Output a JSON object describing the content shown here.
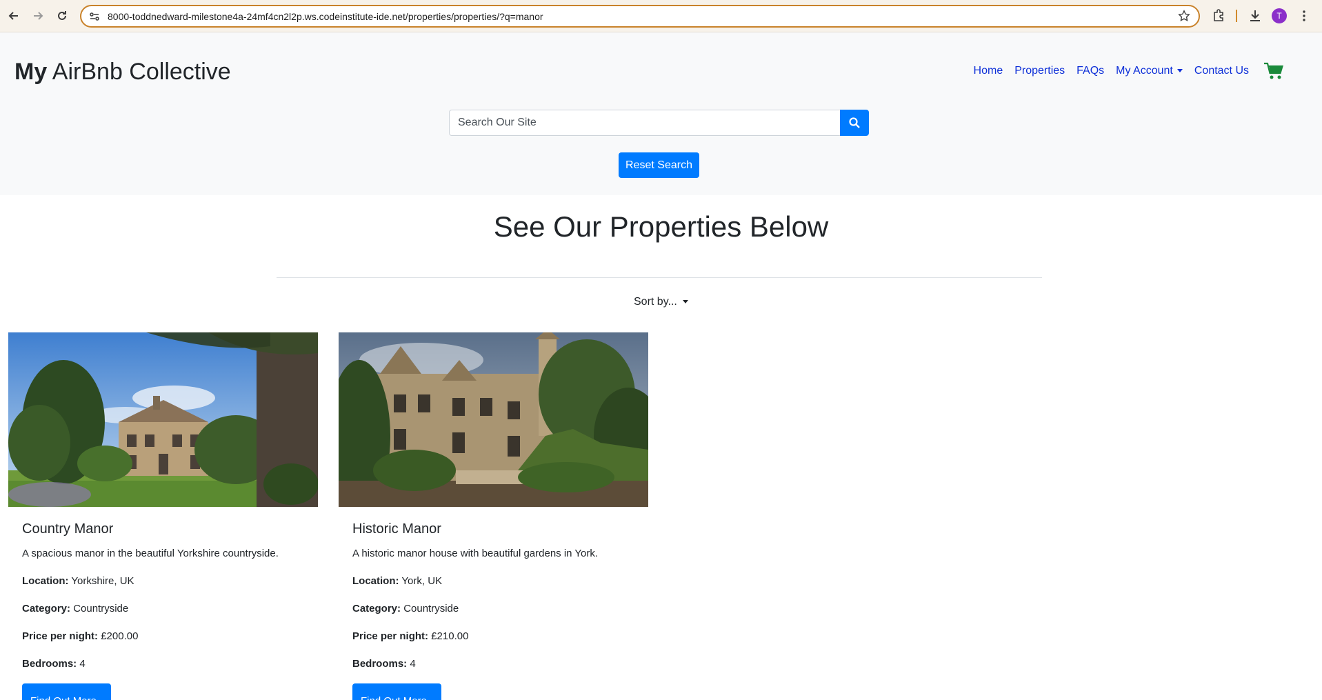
{
  "browser": {
    "url": "8000-toddnedward-milestone4a-24mf4cn2l2p.ws.codeinstitute-ide.net/properties/properties/?q=manor",
    "profile_initial": "T",
    "accent_color": "#c9822a"
  },
  "header": {
    "brand_bold": "My",
    "brand_rest": " AirBnb Collective",
    "nav": {
      "home": "Home",
      "properties": "Properties",
      "faqs": "FAQs",
      "account": "My Account",
      "contact": "Contact Us"
    },
    "cart_icon": "shopping-cart-icon",
    "search_placeholder": "Search Our Site",
    "search_icon": "search-icon",
    "reset_label": "Reset Search"
  },
  "main": {
    "heading": "See Our Properties Below",
    "sort_label": "Sort by..."
  },
  "properties": [
    {
      "title": "Country Manor",
      "description": "A spacious manor in the beautiful Yorkshire countryside.",
      "location_label": "Location:",
      "location": "Yorkshire, UK",
      "category_label": "Category:",
      "category": "Countryside",
      "price_label": "Price per night:",
      "price": "£200.00",
      "bedrooms_label": "Bedrooms:",
      "bedrooms": "4",
      "button_label": "Find Out More"
    },
    {
      "title": "Historic Manor",
      "description": "A historic manor house with beautiful gardens in York.",
      "location_label": "Location:",
      "location": "York, UK",
      "category_label": "Category:",
      "category": "Countryside",
      "price_label": "Price per night:",
      "price": "£210.00",
      "bedrooms_label": "Bedrooms:",
      "bedrooms": "4",
      "button_label": "Find Out More"
    }
  ],
  "colors": {
    "primary": "#007bff",
    "link": "#0d2fd8",
    "cart": "#1a8a3a",
    "header_bg": "#f8f9fa"
  }
}
